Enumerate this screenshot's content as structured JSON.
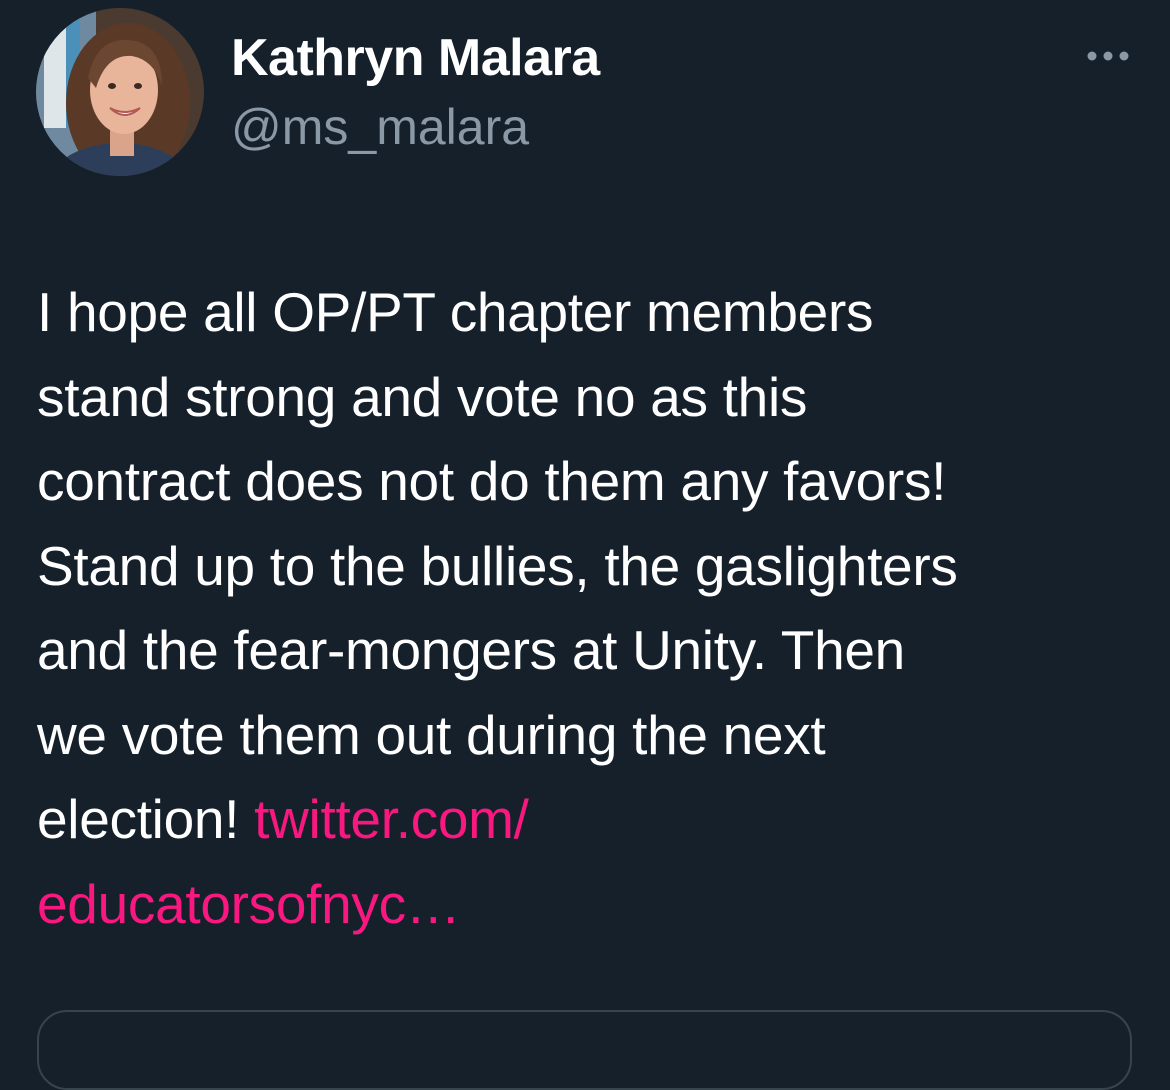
{
  "tweet": {
    "author": {
      "name": "Kathryn Malara",
      "handle": "@ms_malara"
    },
    "text_lines": [
      "I hope all OP/PT chapter members",
      "stand strong and vote no as this",
      "contract does not do them any favors!",
      "Stand up to the bullies, the gaslighters",
      "and the fear-mongers at Unity. Then",
      "we vote them out during the next",
      "election! "
    ],
    "link": {
      "line1": "twitter.com/",
      "line2": "educatorsofnyc…"
    },
    "more_icon": "more-horizontal-icon"
  },
  "colors": {
    "background": "#15202b",
    "text": "#ffffff",
    "secondary_text": "#8b98a5",
    "link": "#f91880",
    "border": "#38444d"
  }
}
